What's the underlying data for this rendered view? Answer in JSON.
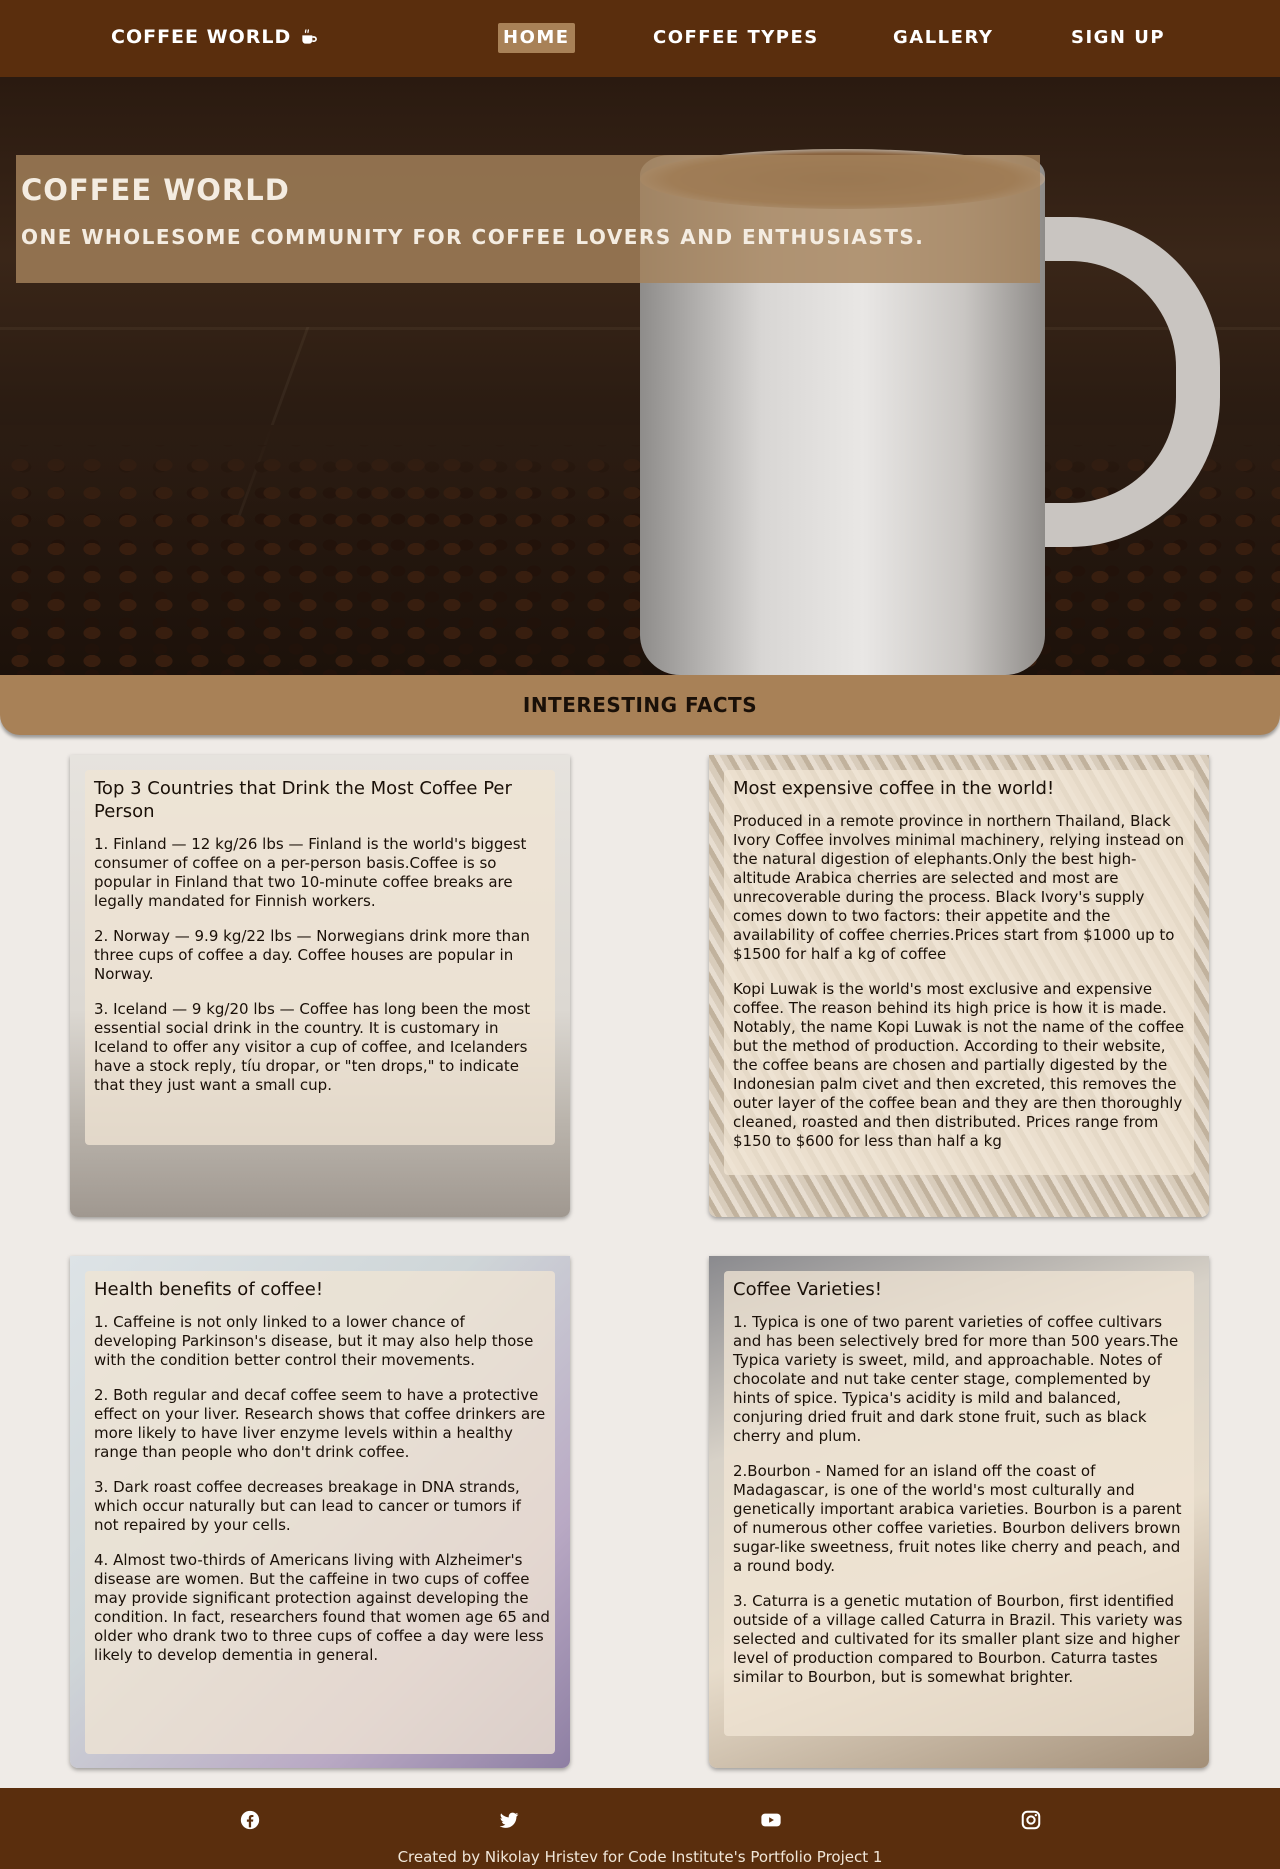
{
  "nav": {
    "brand": "COFFEE WORLD",
    "brand_icon": "mug-hot-icon",
    "links": [
      {
        "label": "HOME",
        "active": true
      },
      {
        "label": "COFFEE TYPES",
        "active": false
      },
      {
        "label": "GALLERY",
        "active": false
      },
      {
        "label": "SIGN UP",
        "active": false
      }
    ]
  },
  "hero": {
    "title": "COFFEE WORLD",
    "subtitle": "ONE WHOLESOME COMMUNITY FOR COFFEE LOVERS AND ENTHUSIASTS."
  },
  "facts": {
    "heading": "INTERESTING FACTS",
    "cards": [
      {
        "title": "Top 3 Countries that Drink the Most Coffee Per Person",
        "paragraphs": [
          "1. Finland — 12 kg/26 lbs — Finland is the world's biggest consumer of coffee on a per-person basis.Coffee is so popular in Finland that two 10-minute coffee breaks are legally mandated for Finnish workers.",
          "2. Norway — 9.9 kg/22 lbs — Norwegians drink more than three cups of coffee a day. Coffee houses are popular in Norway.",
          "3. Iceland — 9 kg/20 lbs — Coffee has long been the most essential social drink in the country. It is customary in Iceland to offer any visitor a cup of coffee, and Icelanders have a stock reply, tíu dropar, or \"ten drops,\" to indicate that they just want a small cup."
        ]
      },
      {
        "title": "Most expensive coffee in the world!",
        "paragraphs": [
          "Produced in a remote province in northern Thailand, Black Ivory Coffee involves minimal machinery, relying instead on the natural digestion of elephants.Only the best high-altitude Arabica cherries are selected and most are unrecoverable during the process. Black Ivory's supply comes down to two factors: their appetite and the availability of coffee cherries.Prices start from $1000 up to $1500 for half a kg of coffee",
          "Kopi Luwak is the world's most exclusive and expensive coffee. The reason behind its high price is how it is made. Notably, the name Kopi Luwak is not the name of the coffee but the method of production. According to their website, the coffee beans are chosen and partially digested by the Indonesian palm civet and then excreted, this removes the outer layer of the coffee bean and they are then thoroughly cleaned, roasted and then distributed. Prices range from $150 to $600 for less than half a kg"
        ]
      },
      {
        "title": "Health benefits of coffee!",
        "paragraphs": [
          "1. Caffeine is not only linked to a lower chance of developing Parkinson's disease, but it may also help those with the condition better control their movements.",
          "2. Both regular and decaf coffee seem to have a protective effect on your liver. Research shows that coffee drinkers are more likely to have liver enzyme levels within a healthy range than people who don't drink coffee.",
          "3. Dark roast coffee decreases breakage in DNA strands, which occur naturally but can lead to cancer or tumors if not repaired by your cells.",
          "4. Almost two-thirds of Americans living with Alzheimer's disease are women. But the caffeine in two cups of coffee may provide significant protection against developing the condition. In fact, researchers found that women age 65 and older who drank two to three cups of coffee a day were less likely to develop dementia in general."
        ]
      },
      {
        "title": "Coffee Varieties!",
        "paragraphs": [
          "1. Typica is one of two parent varieties of coffee cultivars and has been selectively bred for more than 500 years.The Typica variety is sweet, mild, and approachable. Notes of chocolate and nut take center stage, complemented by hints of spice. Typica's acidity is mild and balanced, conjuring dried fruit and dark stone fruit, such as black cherry and plum.",
          "2.Bourbon - Named for an island off the coast of Madagascar, is one of the world's most culturally and genetically important arabica varieties. Bourbon is a parent of numerous other coffee varieties. Bourbon delivers brown sugar-like sweetness, fruit notes like cherry and peach, and a round body.",
          "3. Caturra is a genetic mutation of Bourbon, first identified outside of a village called Caturra in Brazil. This variety was selected and cultivated for its smaller plant size and higher level of production compared to Bourbon. Caturra tastes similar to Bourbon, but is somewhat brighter."
        ]
      }
    ]
  },
  "footer": {
    "social_icons": [
      "facebook-icon",
      "twitter-icon",
      "youtube-icon",
      "instagram-icon"
    ],
    "credit": "Created by Nikolay Hristev for Code Institute's Portfolio Project 1"
  },
  "colors": {
    "nav_bg": "#5a2e0d",
    "accent": "#a88157",
    "page_bg": "#efebe7"
  }
}
